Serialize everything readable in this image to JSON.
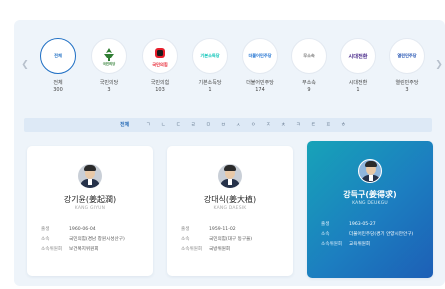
{
  "carousel": {
    "prev_icon": "chevron-left-icon",
    "next_icon": "chevron-right-icon",
    "parties": [
      {
        "logo": "전체",
        "name": "전체",
        "count": "300",
        "color": "#1f6fc4",
        "active": true
      },
      {
        "logo": "국민의힘",
        "name": "국민의당",
        "count": "3",
        "color": "#2f7d32",
        "active": false
      },
      {
        "logo": "국민의힘",
        "name": "국민의힘",
        "count": "103",
        "color": "#e61e2b",
        "active": false
      },
      {
        "logo": "기본소득당",
        "name": "기본소득당",
        "count": "1",
        "color": "#00c2b5",
        "active": false
      },
      {
        "logo": "더불어민주당",
        "name": "더불어민주당",
        "count": "174",
        "color": "#1b6fd0",
        "active": false
      },
      {
        "logo": "무소속",
        "name": "무소속",
        "count": "9",
        "color": "#777777",
        "active": false
      },
      {
        "logo": "시대전환",
        "name": "시대전환",
        "count": "1",
        "color": "#4b2c8c",
        "active": false
      },
      {
        "logo": "열린민주당",
        "name": "열린민주당",
        "count": "3",
        "color": "#1e4fb0",
        "active": false
      }
    ]
  },
  "filter": {
    "items": [
      "전체",
      "ㄱ",
      "ㄴ",
      "ㄷ",
      "ㄹ",
      "ㅁ",
      "ㅂ",
      "ㅅ",
      "ㅇ",
      "ㅈ",
      "ㅊ",
      "ㅋ",
      "ㅌ",
      "ㅍ",
      "ㅎ"
    ],
    "active": "전체"
  },
  "members": [
    {
      "name": "강기윤(姜起潤)",
      "roman": "KANG GIYUN",
      "rows": [
        {
          "k": "출생",
          "v": "1960-06-04"
        },
        {
          "k": "소속",
          "v": "국민의힘(경남 창원시성산구)"
        },
        {
          "k": "소속위원회",
          "v": "보건복지위원회"
        }
      ]
    },
    {
      "name": "강대식(姜大植)",
      "roman": "KANG DAESIK",
      "rows": [
        {
          "k": "출생",
          "v": "1959-11-02"
        },
        {
          "k": "소속",
          "v": "국민의힘(대구 동구을)"
        },
        {
          "k": "소속위원회",
          "v": "국방위원회"
        }
      ]
    },
    {
      "name": "강득구(姜得求)",
      "roman": "KANG DEUKGU",
      "rows": [
        {
          "k": "출생",
          "v": "1963-05-27"
        },
        {
          "k": "소속",
          "v": "더불어민주당(경기 안양시만안구)"
        },
        {
          "k": "소속위원회",
          "v": "교육위원회"
        }
      ]
    }
  ]
}
